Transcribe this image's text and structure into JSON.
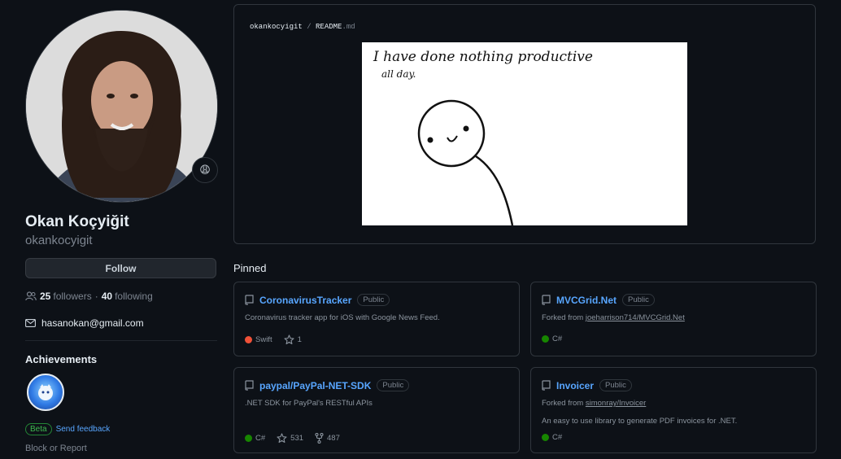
{
  "profile": {
    "fullname": "Okan Koçyiğit",
    "login": "okankocyigit",
    "status_emoji": "😩",
    "follow_label": "Follow",
    "followers_count": "25",
    "followers_label": "followers",
    "separator": "·",
    "following_count": "40",
    "following_label": "following",
    "email": "hasanokan@gmail.com",
    "achievements_title": "Achievements",
    "beta_label": "Beta",
    "feedback_label": "Send feedback",
    "block_label": "Block or Report"
  },
  "readme": {
    "owner": "okankocyigit",
    "sep": "/",
    "file": "README",
    "ext": ".md",
    "comic_line1": "I have done nothing productive",
    "comic_line2": "all day."
  },
  "pinned": {
    "title": "Pinned",
    "cards": [
      {
        "name": "CoronavirusTracker",
        "visibility": "Public",
        "description": "Coronavirus tracker app for iOS with Google News Feed.",
        "language": "Swift",
        "language_color": "#F05138",
        "stars": "1"
      },
      {
        "name": "MVCGrid.Net",
        "visibility": "Public",
        "forked_prefix": "Forked from",
        "forked_from": "joeharrison714/MVCGrid.Net",
        "language": "C#",
        "language_color": "#178600"
      },
      {
        "name": "paypal/PayPal-NET-SDK",
        "visibility": "Public",
        "description": ".NET SDK for PayPal's RESTful APIs",
        "language": "C#",
        "language_color": "#178600",
        "stars": "531",
        "forks": "487"
      },
      {
        "name": "Invoicer",
        "visibility": "Public",
        "forked_prefix": "Forked from",
        "forked_from": "simonray/Invoicer",
        "description": "An easy to use library to generate PDF invoices for .NET.",
        "language": "C#",
        "language_color": "#178600"
      }
    ]
  }
}
